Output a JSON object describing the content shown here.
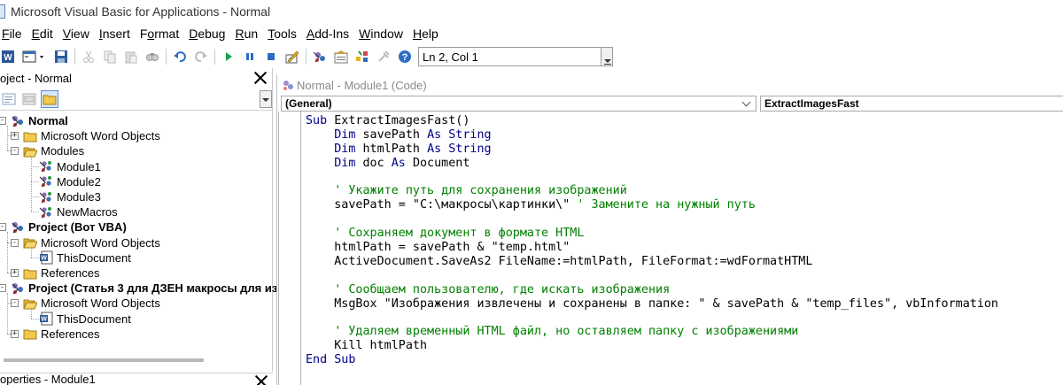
{
  "window": {
    "title": "Microsoft Visual Basic for Applications - Normal"
  },
  "menu": [
    {
      "label": "File",
      "key": "F",
      "rest": "ile"
    },
    {
      "label": "Edit",
      "key": "E",
      "rest": "dit"
    },
    {
      "label": "View",
      "key": "V",
      "rest": "iew"
    },
    {
      "label": "Insert",
      "key": "I",
      "rest": "nsert"
    },
    {
      "label": "Format",
      "key": "o",
      "pre": "F",
      "rest": "rmat"
    },
    {
      "label": "Debug",
      "key": "D",
      "rest": "ebug"
    },
    {
      "label": "Run",
      "key": "R",
      "rest": "un"
    },
    {
      "label": "Tools",
      "key": "T",
      "rest": "ools"
    },
    {
      "label": "Add-Ins",
      "key": "A",
      "rest": "dd-Ins"
    },
    {
      "label": "Window",
      "key": "W",
      "rest": "indow"
    },
    {
      "label": "Help",
      "key": "H",
      "rest": "elp"
    }
  ],
  "toolbar": {
    "position": "Ln 2, Col 1",
    "icons": [
      "word-icon",
      "insert-userform-icon",
      "save-icon",
      "cut-icon",
      "copy-icon",
      "paste-icon",
      "find-icon",
      "undo-icon",
      "redo-icon",
      "run-icon",
      "break-icon",
      "reset-icon",
      "design-mode-icon",
      "project-explorer-icon",
      "properties-icon",
      "object-browser-icon",
      "toolbox-icon",
      "help-icon"
    ]
  },
  "project_pane": {
    "title": "oject - Normal",
    "tree": [
      {
        "label": "Normal",
        "bold": true,
        "icon": "vba-project-icon",
        "exp": "-",
        "level": 0
      },
      {
        "label": "Microsoft Word Objects",
        "icon": "folder-icon",
        "exp": "+",
        "level": 1
      },
      {
        "label": "Modules",
        "icon": "folder-open-icon",
        "exp": "-",
        "level": 1
      },
      {
        "label": "Module1",
        "icon": "module-icon",
        "level": 2,
        "selected": true
      },
      {
        "label": "Module2",
        "icon": "module-icon",
        "level": 2
      },
      {
        "label": "Module3",
        "icon": "module-icon",
        "level": 2
      },
      {
        "label": "NewMacros",
        "icon": "module-icon",
        "level": 2
      },
      {
        "label": "Project (Вот VBA)",
        "bold": true,
        "icon": "vba-project-icon",
        "exp": "-",
        "level": 0
      },
      {
        "label": "Microsoft Word Objects",
        "icon": "folder-open-icon",
        "exp": "-",
        "level": 1
      },
      {
        "label": "ThisDocument",
        "icon": "word-document-icon",
        "level": 2
      },
      {
        "label": "References",
        "icon": "folder-icon",
        "exp": "+",
        "level": 1
      },
      {
        "label": "Project (Статья 3 для ДЗЕН макросы для из",
        "bold": true,
        "icon": "vba-project-icon",
        "exp": "-",
        "level": 0
      },
      {
        "label": "Microsoft Word Objects",
        "icon": "folder-open-icon",
        "exp": "-",
        "level": 1
      },
      {
        "label": "ThisDocument",
        "icon": "word-document-icon",
        "level": 2
      },
      {
        "label": "References",
        "icon": "folder-icon",
        "exp": "+",
        "level": 1
      }
    ]
  },
  "properties_pane": {
    "title": "operties - Module1"
  },
  "code_window": {
    "title": "Normal - Module1 (Code)",
    "object_combo": "(General)",
    "procedure_combo": "ExtractImagesFast",
    "lines": [
      [
        {
          "t": "kw",
          "s": "Sub "
        },
        {
          "t": "tx",
          "s": "ExtractImagesFast()"
        }
      ],
      [
        {
          "t": "kw",
          "s": "    Dim "
        },
        {
          "t": "tx",
          "s": "savePath "
        },
        {
          "t": "kw",
          "s": "As String"
        }
      ],
      [
        {
          "t": "kw",
          "s": "    Dim "
        },
        {
          "t": "tx",
          "s": "htmlPath "
        },
        {
          "t": "kw",
          "s": "As String"
        }
      ],
      [
        {
          "t": "kw",
          "s": "    Dim "
        },
        {
          "t": "tx",
          "s": "doc "
        },
        {
          "t": "kw",
          "s": "As "
        },
        {
          "t": "tx",
          "s": "Document"
        }
      ],
      [],
      [
        {
          "t": "cm",
          "s": "    ' Укажите путь для сохранения изображений"
        }
      ],
      [
        {
          "t": "tx",
          "s": "    savePath = \"C:\\макросы\\картинки\\\" "
        },
        {
          "t": "cm",
          "s": "' Замените на нужный путь"
        }
      ],
      [],
      [
        {
          "t": "cm",
          "s": "    ' Сохраняем документ в формате HTML"
        }
      ],
      [
        {
          "t": "tx",
          "s": "    htmlPath = savePath & \"temp.html\""
        }
      ],
      [
        {
          "t": "tx",
          "s": "    ActiveDocument.SaveAs2 FileName:=htmlPath, FileFormat:=wdFormatHTML"
        }
      ],
      [],
      [
        {
          "t": "cm",
          "s": "    ' Сообщаем пользователю, где искать изображения"
        }
      ],
      [
        {
          "t": "tx",
          "s": "    MsgBox \"Изображения извлечены и сохранены в папке: \" & savePath & \"temp_files\", vbInformation"
        }
      ],
      [],
      [
        {
          "t": "cm",
          "s": "    ' Удаляем временный HTML файл, но оставляем папку с изображениями"
        }
      ],
      [
        {
          "t": "tx",
          "s": "    Kill htmlPath"
        }
      ],
      [
        {
          "t": "kw",
          "s": "End Sub"
        }
      ]
    ]
  },
  "colors": {
    "keyword": "#00008b",
    "comment": "#008000",
    "accent": "#5b8fd6"
  }
}
